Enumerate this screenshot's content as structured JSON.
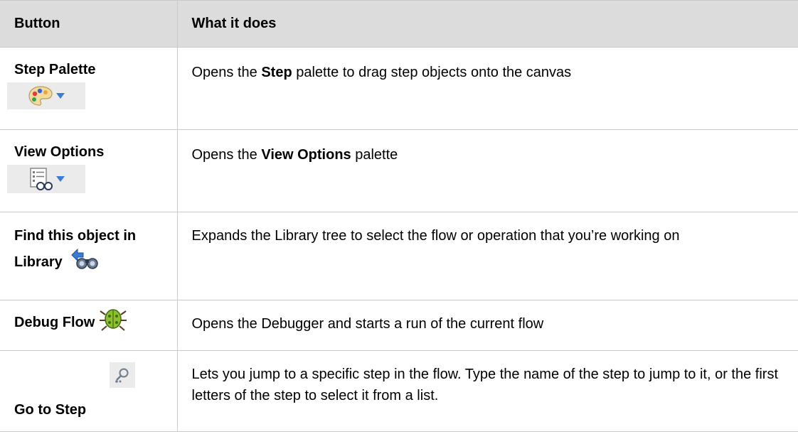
{
  "headers": {
    "button": "Button",
    "what": "What it does"
  },
  "rows": [
    {
      "button": "Step Palette",
      "icon": "palette-icon",
      "desc_pre": "Opens the ",
      "desc_bold": "Step",
      "desc_post": " palette to drag step objects onto the canvas"
    },
    {
      "button": "View Options",
      "icon": "view-options-icon",
      "desc_pre": "Opens the ",
      "desc_bold": "View Options",
      "desc_post": " palette"
    },
    {
      "button_line1": "Find this object in",
      "button_line2": "Library",
      "icon": "binoculars-icon",
      "desc": "Expands the Library tree to select the flow or operation that you’re working on"
    },
    {
      "button": "Debug Flow",
      "icon": "debug-bug-icon",
      "desc": "Opens the Debugger and starts a run of the current flow"
    },
    {
      "button": "Go to Step",
      "icon": "go-to-step-icon",
      "desc": "Lets you jump to a specific step in the flow. Type the name of the step to jump to it, or the first letters of the step to select it from a list."
    }
  ],
  "colors": {
    "header_bg": "#dcdcdc",
    "border": "#c9c9c9",
    "dropdown_arrow": "#3a7bd5"
  }
}
